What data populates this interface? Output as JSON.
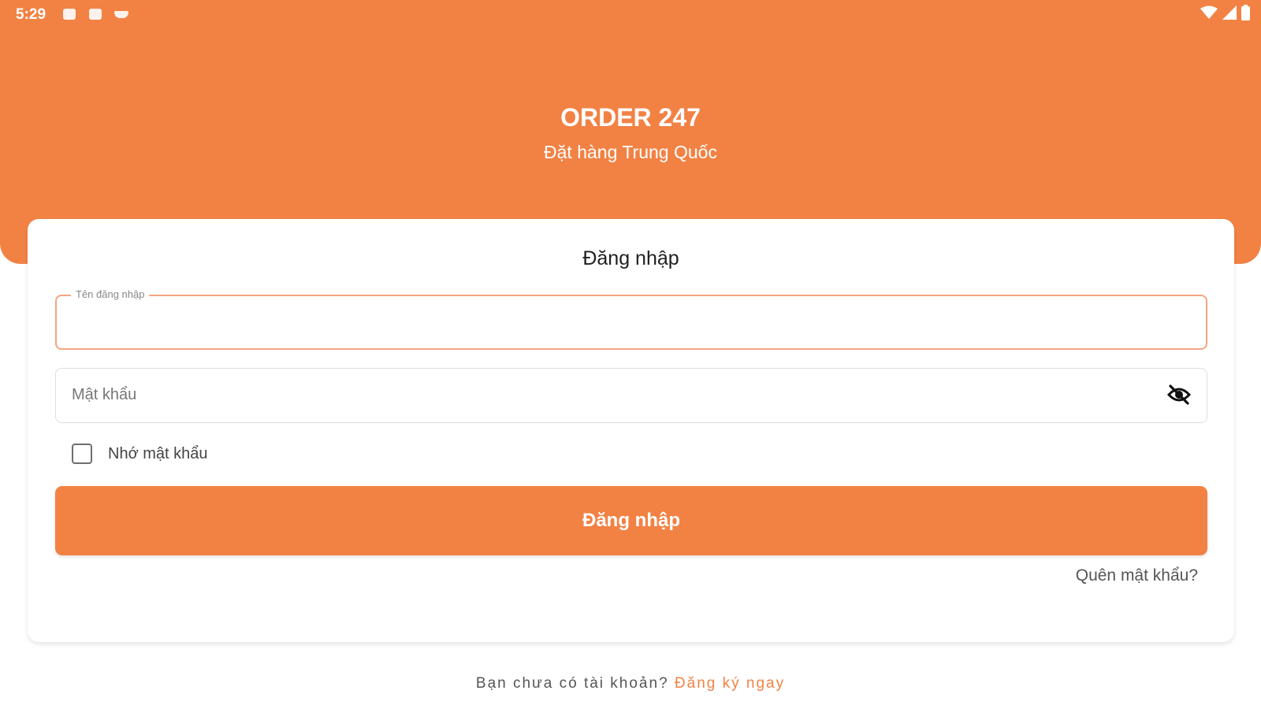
{
  "status_bar": {
    "time": "5:29",
    "left_icons": [
      "image-icon",
      "app-notification-icon",
      "cloud-icon"
    ],
    "right_icons": [
      "wifi-icon",
      "signal-icon",
      "battery-icon"
    ]
  },
  "header": {
    "title": "ORDER 247",
    "subtitle": "Đặt hàng Trung Quốc"
  },
  "login_card": {
    "title": "Đăng nhập",
    "username": {
      "label": "Tên đăng nhập",
      "value": ""
    },
    "password": {
      "placeholder": "Mật khẩu",
      "value": "",
      "toggle_icon": "eye-off-icon"
    },
    "remember": {
      "label": "Nhớ mật khẩu",
      "checked": false
    },
    "login_button": "Đăng nhập",
    "forgot_password": "Quên mật khẩu?"
  },
  "footer": {
    "prompt": "Bạn chưa có tài khoản?",
    "register_link": "Đăng ký ngay"
  },
  "colors": {
    "accent": "#F28244",
    "focused_border": "#F4A582",
    "background": "#FFFFFF"
  }
}
